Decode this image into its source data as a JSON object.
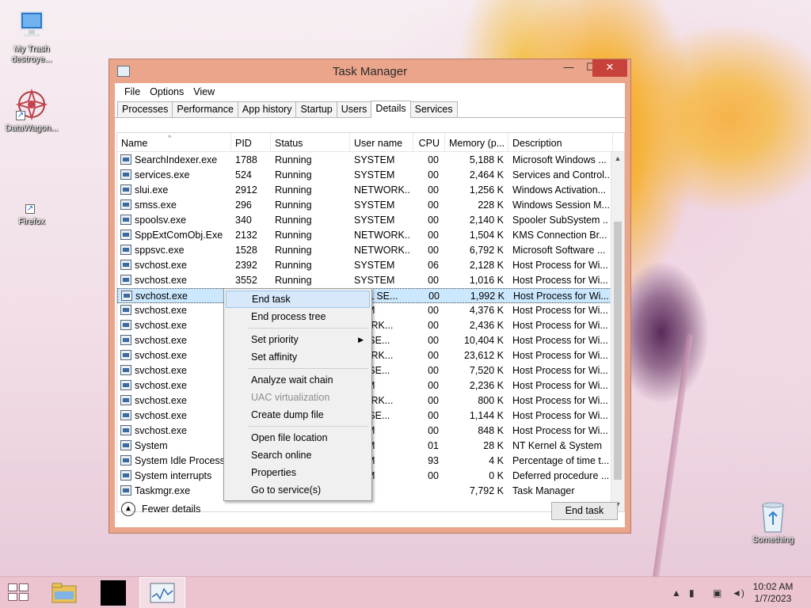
{
  "desktop": {
    "icons": [
      {
        "label": "My Trash destroye...",
        "icon": "computer-icon"
      },
      {
        "label": "DataWagon...",
        "icon": "datawagon-icon"
      },
      {
        "label": "Firefox",
        "icon": "firefox-shortcut-icon"
      },
      {
        "label": "Something",
        "icon": "recycle-bin-icon"
      }
    ]
  },
  "window": {
    "title": "Task Manager",
    "menu": [
      "File",
      "Options",
      "View"
    ],
    "tabs": [
      "Processes",
      "Performance",
      "App history",
      "Startup",
      "Users",
      "Details",
      "Services"
    ],
    "active_tab": "Details",
    "columns": [
      "Name",
      "PID",
      "Status",
      "User name",
      "CPU",
      "Memory (p...",
      "Description"
    ],
    "rows": [
      {
        "name": "SearchIndexer.exe",
        "pid": "1788",
        "status": "Running",
        "user": "SYSTEM",
        "cpu": "00",
        "memory": "5,188 K",
        "desc": "Microsoft Windows ..."
      },
      {
        "name": "services.exe",
        "pid": "524",
        "status": "Running",
        "user": "SYSTEM",
        "cpu": "00",
        "memory": "2,464 K",
        "desc": "Services and Control..."
      },
      {
        "name": "slui.exe",
        "pid": "2912",
        "status": "Running",
        "user": "NETWORK...",
        "cpu": "00",
        "memory": "1,256 K",
        "desc": "Windows Activation..."
      },
      {
        "name": "smss.exe",
        "pid": "296",
        "status": "Running",
        "user": "SYSTEM",
        "cpu": "00",
        "memory": "228 K",
        "desc": "Windows Session M..."
      },
      {
        "name": "spoolsv.exe",
        "pid": "340",
        "status": "Running",
        "user": "SYSTEM",
        "cpu": "00",
        "memory": "2,140 K",
        "desc": "Spooler SubSystem ..."
      },
      {
        "name": "SppExtComObj.Exe",
        "pid": "2132",
        "status": "Running",
        "user": "NETWORK...",
        "cpu": "00",
        "memory": "1,504 K",
        "desc": "KMS Connection Br..."
      },
      {
        "name": "sppsvc.exe",
        "pid": "1528",
        "status": "Running",
        "user": "NETWORK...",
        "cpu": "00",
        "memory": "6,792 K",
        "desc": "Microsoft Software ..."
      },
      {
        "name": "svchost.exe",
        "pid": "2392",
        "status": "Running",
        "user": "SYSTEM",
        "cpu": "06",
        "memory": "2,128 K",
        "desc": "Host Process for Wi..."
      },
      {
        "name": "svchost.exe",
        "pid": "3552",
        "status": "Running",
        "user": "SYSTEM",
        "cpu": "00",
        "memory": "1,016 K",
        "desc": "Host Process for Wi..."
      },
      {
        "name": "svchost.exe",
        "pid": "",
        "status": "",
        "user": "CAL SE...",
        "cpu": "00",
        "memory": "1,992 K",
        "desc": "Host Process for Wi...",
        "selected": true
      },
      {
        "name": "svchost.exe",
        "pid": "",
        "status": "",
        "user": "TEM",
        "cpu": "00",
        "memory": "4,376 K",
        "desc": "Host Process for Wi..."
      },
      {
        "name": "svchost.exe",
        "pid": "",
        "status": "",
        "user": "WORK...",
        "cpu": "00",
        "memory": "2,436 K",
        "desc": "Host Process for Wi..."
      },
      {
        "name": "svchost.exe",
        "pid": "",
        "status": "",
        "user": "AL SE...",
        "cpu": "00",
        "memory": "10,404 K",
        "desc": "Host Process for Wi..."
      },
      {
        "name": "svchost.exe",
        "pid": "",
        "status": "",
        "user": "WORK...",
        "cpu": "00",
        "memory": "23,612 K",
        "desc": "Host Process for Wi..."
      },
      {
        "name": "svchost.exe",
        "pid": "",
        "status": "",
        "user": "AL SE...",
        "cpu": "00",
        "memory": "7,520 K",
        "desc": "Host Process for Wi..."
      },
      {
        "name": "svchost.exe",
        "pid": "",
        "status": "",
        "user": "TEM",
        "cpu": "00",
        "memory": "2,236 K",
        "desc": "Host Process for Wi..."
      },
      {
        "name": "svchost.exe",
        "pid": "",
        "status": "",
        "user": "WORK...",
        "cpu": "00",
        "memory": "800 K",
        "desc": "Host Process for Wi..."
      },
      {
        "name": "svchost.exe",
        "pid": "",
        "status": "",
        "user": "AL SE...",
        "cpu": "00",
        "memory": "1,144 K",
        "desc": "Host Process for Wi..."
      },
      {
        "name": "svchost.exe",
        "pid": "",
        "status": "",
        "user": "TEM",
        "cpu": "00",
        "memory": "848 K",
        "desc": "Host Process for Wi..."
      },
      {
        "name": "System",
        "pid": "",
        "status": "",
        "user": "TEM",
        "cpu": "01",
        "memory": "28 K",
        "desc": "NT Kernel & System"
      },
      {
        "name": "System Idle Process",
        "pid": "",
        "status": "",
        "user": "TEM",
        "cpu": "93",
        "memory": "4 K",
        "desc": "Percentage of time t..."
      },
      {
        "name": "System interrupts",
        "pid": "",
        "status": "",
        "user": "TEM",
        "cpu": "00",
        "memory": "0 K",
        "desc": "Deferred procedure ..."
      },
      {
        "name": "Taskmgr.exe",
        "pid": "",
        "status": "",
        "user": "",
        "cpu": "",
        "memory": "7,792 K",
        "desc": "Task Manager"
      }
    ],
    "fewer_details": "Fewer details",
    "end_task": "End task"
  },
  "context_menu": [
    {
      "label": "End task",
      "highlighted": true
    },
    {
      "label": "End process tree"
    },
    {
      "sep": true
    },
    {
      "label": "Set priority",
      "submenu": true
    },
    {
      "label": "Set affinity"
    },
    {
      "sep": true
    },
    {
      "label": "Analyze wait chain"
    },
    {
      "label": "UAC virtualization",
      "disabled": true
    },
    {
      "label": "Create dump file"
    },
    {
      "sep": true
    },
    {
      "label": "Open file location"
    },
    {
      "label": "Search online"
    },
    {
      "label": "Properties"
    },
    {
      "label": "Go to service(s)"
    }
  ],
  "taskbar": {
    "time": "10:02 AM",
    "date": "1/7/2023",
    "buttons": [
      "start-icon",
      "file-explorer-icon",
      "console-icon",
      "task-manager-icon"
    ]
  }
}
